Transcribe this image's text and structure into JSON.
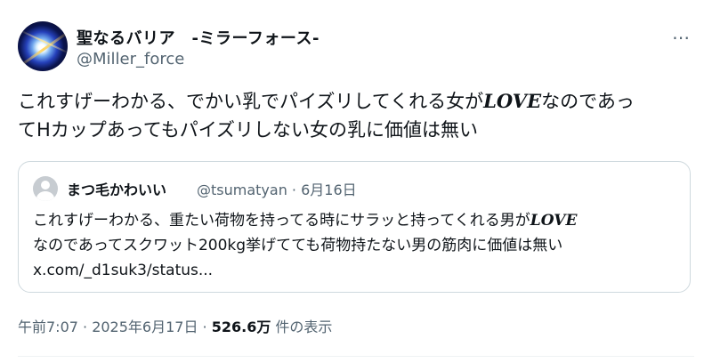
{
  "author": {
    "display_name": "聖なるバリア　-ミラーフォース-",
    "handle": "@Miller_force"
  },
  "more_icon": "⋯",
  "tweet": {
    "line1_before": "これすげーわかる、でかい乳でパイズリしてくれる女が",
    "line1_love": "LOVE",
    "line1_after": "なのであっ",
    "line2": "てHカップあってもパイズリしない女の乳に価値は無い"
  },
  "quote": {
    "name": "まつ毛かわいい",
    "meta": "@tsumatyan · 6月16日",
    "line1_before": "これすげーわかる、重たい荷物を持ってる時にサラッと持ってくれる男が",
    "line1_love": "LOVE",
    "line2": "なのであってスクワット200kg挙げてても荷物持たない男の筋肉に価値は無い",
    "line3": "x.com/_d1suk3/status..."
  },
  "footer": {
    "time_date": "午前7:07 · 2025年6月17日 · ",
    "views_count": "526.6万",
    "views_label": " 件の表示"
  }
}
